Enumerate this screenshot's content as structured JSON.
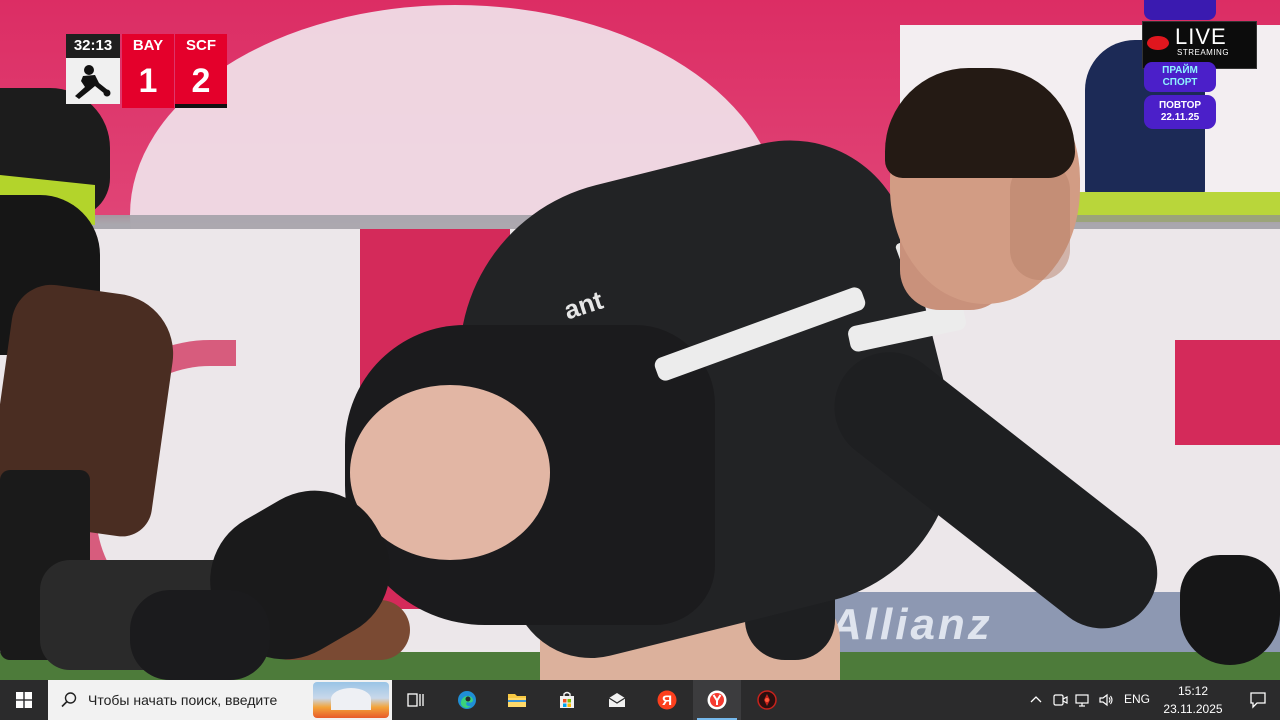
{
  "scoreboard": {
    "clock": "32:13",
    "home_team": "BAY",
    "away_team": "SCF",
    "home_score": "1",
    "away_score": "2",
    "league_logo_icon": "bundesliga-logo-icon",
    "accent_color": "#e4002b"
  },
  "broadcast": {
    "live_label": "LIVE",
    "live_sub": "STREAMING",
    "channel_line1": "ПРАЙМ",
    "channel_line2": "СПОРТ",
    "repeat_line1": "ПОВТОР",
    "repeat_line2": "22.11.25",
    "badge_color": "#4b1fc9"
  },
  "scene": {
    "shirt_text": "ant",
    "banner_text": "Allianz"
  },
  "taskbar": {
    "search_placeholder": "Чтобы начать поиск, введите",
    "apps": [
      {
        "name": "task-view-icon"
      },
      {
        "name": "edge-icon"
      },
      {
        "name": "file-explorer-icon"
      },
      {
        "name": "microsoft-store-icon"
      },
      {
        "name": "mail-icon"
      },
      {
        "name": "yandex-icon"
      },
      {
        "name": "yandex-browser-icon"
      },
      {
        "name": "media-app-icon"
      }
    ],
    "tray": {
      "language": "ENG",
      "time": "15:12",
      "date": "23.11.2025"
    }
  }
}
